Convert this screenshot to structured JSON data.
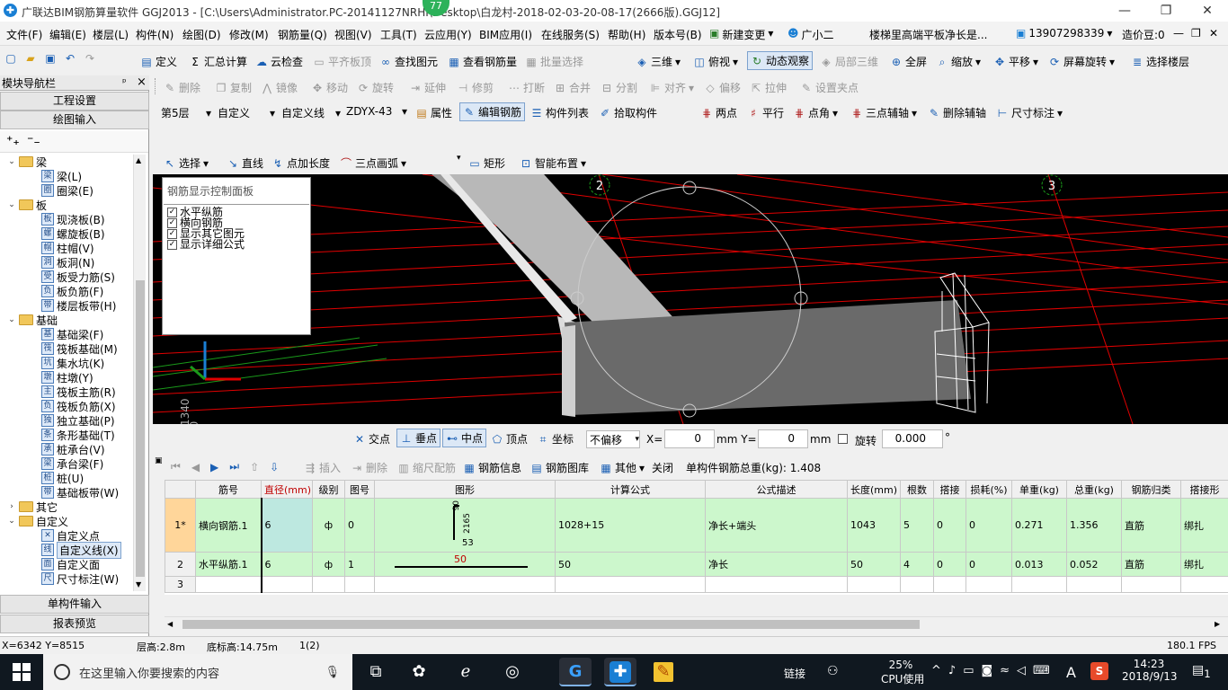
{
  "window": {
    "title": "广联达BIM钢筋算量软件 GGJ2013 - [C:\\Users\\Administrator.PC-20141127NRHI\\Desktop\\白龙村-2018-02-03-20-08-17(2666版).GGJ12]",
    "badge": "77",
    "min": "—",
    "restore": "❐",
    "close": "✕"
  },
  "menu": [
    "文件(F)",
    "编辑(E)",
    "楼层(L)",
    "构件(N)",
    "绘图(D)",
    "修改(M)",
    "钢筋量(Q)",
    "视图(V)",
    "工具(T)",
    "云应用(Y)",
    "BIM应用(I)",
    "在线服务(S)",
    "帮助(H)",
    "版本号(B)",
    "新建变更",
    "广小二",
    "楼梯里高端平板净长是...",
    "13907298339",
    "造价豆:0"
  ],
  "toolbar1": [
    "定义",
    "汇总计算",
    "云检查",
    "平齐板顶",
    "查找图元",
    "查看钢筋量",
    "批量选择",
    "三维",
    "俯视",
    "动态观察",
    "局部三维",
    "全屏",
    "缩放",
    "平移",
    "屏幕旋转",
    "选择楼层"
  ],
  "toolbar2": [
    "删除",
    "复制",
    "镜像",
    "移动",
    "旋转",
    "延伸",
    "修剪",
    "打断",
    "合并",
    "分割",
    "对齐",
    "偏移",
    "拉伸",
    "设置夹点"
  ],
  "toolbar3": {
    "floor": "第5层",
    "category": "自定义",
    "type": "自定义线",
    "component": "ZDYX-43",
    "items": [
      "属性",
      "编辑钢筋",
      "构件列表",
      "拾取构件",
      "两点",
      "平行",
      "点角",
      "三点辅轴",
      "删除辅轴",
      "尺寸标注"
    ]
  },
  "toolbar4": [
    "选择",
    "直线",
    "点加长度",
    "三点画弧",
    "矩形",
    "智能布置"
  ],
  "nav": {
    "title": "模块导航栏",
    "pin": "ᵖ",
    "close": "×",
    "btn_project": "工程设置",
    "btn_draw": "绘图输入",
    "btn_single": "单构件输入",
    "btn_report": "报表预览",
    "tree": [
      {
        "t": "group",
        "label": "梁",
        "open": true
      },
      {
        "t": "item",
        "label": "梁(L)",
        "icon": "梁"
      },
      {
        "t": "item",
        "label": "圈梁(E)",
        "icon": "圈"
      },
      {
        "t": "group",
        "label": "板",
        "open": true
      },
      {
        "t": "item",
        "label": "现浇板(B)",
        "icon": "板"
      },
      {
        "t": "item",
        "label": "螺旋板(B)",
        "icon": "螺"
      },
      {
        "t": "item",
        "label": "柱帽(V)",
        "icon": "帽"
      },
      {
        "t": "item",
        "label": "板洞(N)",
        "icon": "洞"
      },
      {
        "t": "item",
        "label": "板受力筋(S)",
        "icon": "受"
      },
      {
        "t": "item",
        "label": "板负筋(F)",
        "icon": "负"
      },
      {
        "t": "item",
        "label": "楼层板带(H)",
        "icon": "带"
      },
      {
        "t": "group",
        "label": "基础",
        "open": true
      },
      {
        "t": "item",
        "label": "基础梁(F)",
        "icon": "基"
      },
      {
        "t": "item",
        "label": "筏板基础(M)",
        "icon": "筏"
      },
      {
        "t": "item",
        "label": "集水坑(K)",
        "icon": "坑"
      },
      {
        "t": "item",
        "label": "柱墩(Y)",
        "icon": "墩"
      },
      {
        "t": "item",
        "label": "筏板主筋(R)",
        "icon": "主"
      },
      {
        "t": "item",
        "label": "筏板负筋(X)",
        "icon": "负"
      },
      {
        "t": "item",
        "label": "独立基础(P)",
        "icon": "独"
      },
      {
        "t": "item",
        "label": "条形基础(T)",
        "icon": "条"
      },
      {
        "t": "item",
        "label": "桩承台(V)",
        "icon": "承"
      },
      {
        "t": "item",
        "label": "承台梁(F)",
        "icon": "梁"
      },
      {
        "t": "item",
        "label": "桩(U)",
        "icon": "桩"
      },
      {
        "t": "item",
        "label": "基础板带(W)",
        "icon": "带"
      },
      {
        "t": "group",
        "label": "其它",
        "open": false
      },
      {
        "t": "group",
        "label": "自定义",
        "open": true
      },
      {
        "t": "item",
        "label": "自定义点",
        "icon": "✕"
      },
      {
        "t": "item",
        "label": "自定义线(X)",
        "icon": "线",
        "selected": true
      },
      {
        "t": "item",
        "label": "自定义面",
        "icon": "面"
      },
      {
        "t": "item",
        "label": "尺寸标注(W)",
        "icon": "尺"
      }
    ]
  },
  "ctrl_panel": {
    "title": "钢筋显示控制面板",
    "options": [
      "水平纵筋",
      "横向钢筋",
      "显示其它图元",
      "显示详细公式"
    ]
  },
  "canvas": {
    "axis2": "2",
    "axis3": "3",
    "axis_text": "1340",
    "axis_text2": "00"
  },
  "snapbar": {
    "items": [
      "交点",
      "垂点",
      "中点",
      "顶点",
      "坐标"
    ],
    "offset_mode": "不偏移",
    "x_label": "X=",
    "x_value": "0",
    "y_label": "mm Y=",
    "y_value": "0",
    "mm": "mm",
    "rotate_label": "旋转",
    "rotate_value": "0.000",
    "deg": "°"
  },
  "bottom_toolbar": {
    "items": [
      "插入",
      "删除",
      "缩尺配筋",
      "钢筋信息",
      "钢筋图库",
      "其他",
      "关闭"
    ],
    "total_label": "单构件钢筋总重(kg): 1.408"
  },
  "table": {
    "headers": [
      "",
      "筋号",
      "直径(mm)",
      "级别",
      "图号",
      "图形",
      "计算公式",
      "公式描述",
      "长度(mm)",
      "根数",
      "搭接",
      "损耗(%)",
      "单重(kg)",
      "总重(kg)",
      "钢筋归类",
      "搭接形"
    ],
    "rows": [
      {
        "no": "1*",
        "name": "横向钢筋.1",
        "dia": "6",
        "grade": "ф",
        "fig": "0",
        "shape_top": "90",
        "shape_mid": "2165",
        "shape_bot": "53",
        "formula": "1028+15",
        "desc": "净长+端头",
        "len": "1043",
        "count": "5",
        "lap": "0",
        "loss": "0",
        "unit": "0.271",
        "total": "1.356",
        "cls": "直筋",
        "laptype": "绑扎"
      },
      {
        "no": "2",
        "name": "水平纵筋.1",
        "dia": "6",
        "grade": "ф",
        "fig": "1",
        "shape_val": "50",
        "formula": "50",
        "desc": "净长",
        "len": "50",
        "count": "4",
        "lap": "0",
        "loss": "0",
        "unit": "0.013",
        "total": "0.052",
        "cls": "直筋",
        "laptype": "绑扎"
      },
      {
        "no": "3",
        "name": "",
        "dia": "",
        "grade": "",
        "fig": "",
        "formula": "",
        "desc": "",
        "len": "",
        "count": "",
        "lap": "",
        "loss": "",
        "unit": "",
        "total": "",
        "cls": "",
        "laptype": ""
      }
    ]
  },
  "status": {
    "coords": "X=6342 Y=8515",
    "floor_height": "层高:2.8m",
    "base_height": "底标高:14.75m",
    "count": "1(2)",
    "fps": "180.1 FPS"
  },
  "taskbar": {
    "search_placeholder": "在这里输入你要搜索的内容",
    "link": "链接",
    "cpu_pct": "25%",
    "cpu_label": "CPU使用",
    "ime": "A",
    "time": "14:23",
    "date": "2018/9/13",
    "notif": "1"
  }
}
